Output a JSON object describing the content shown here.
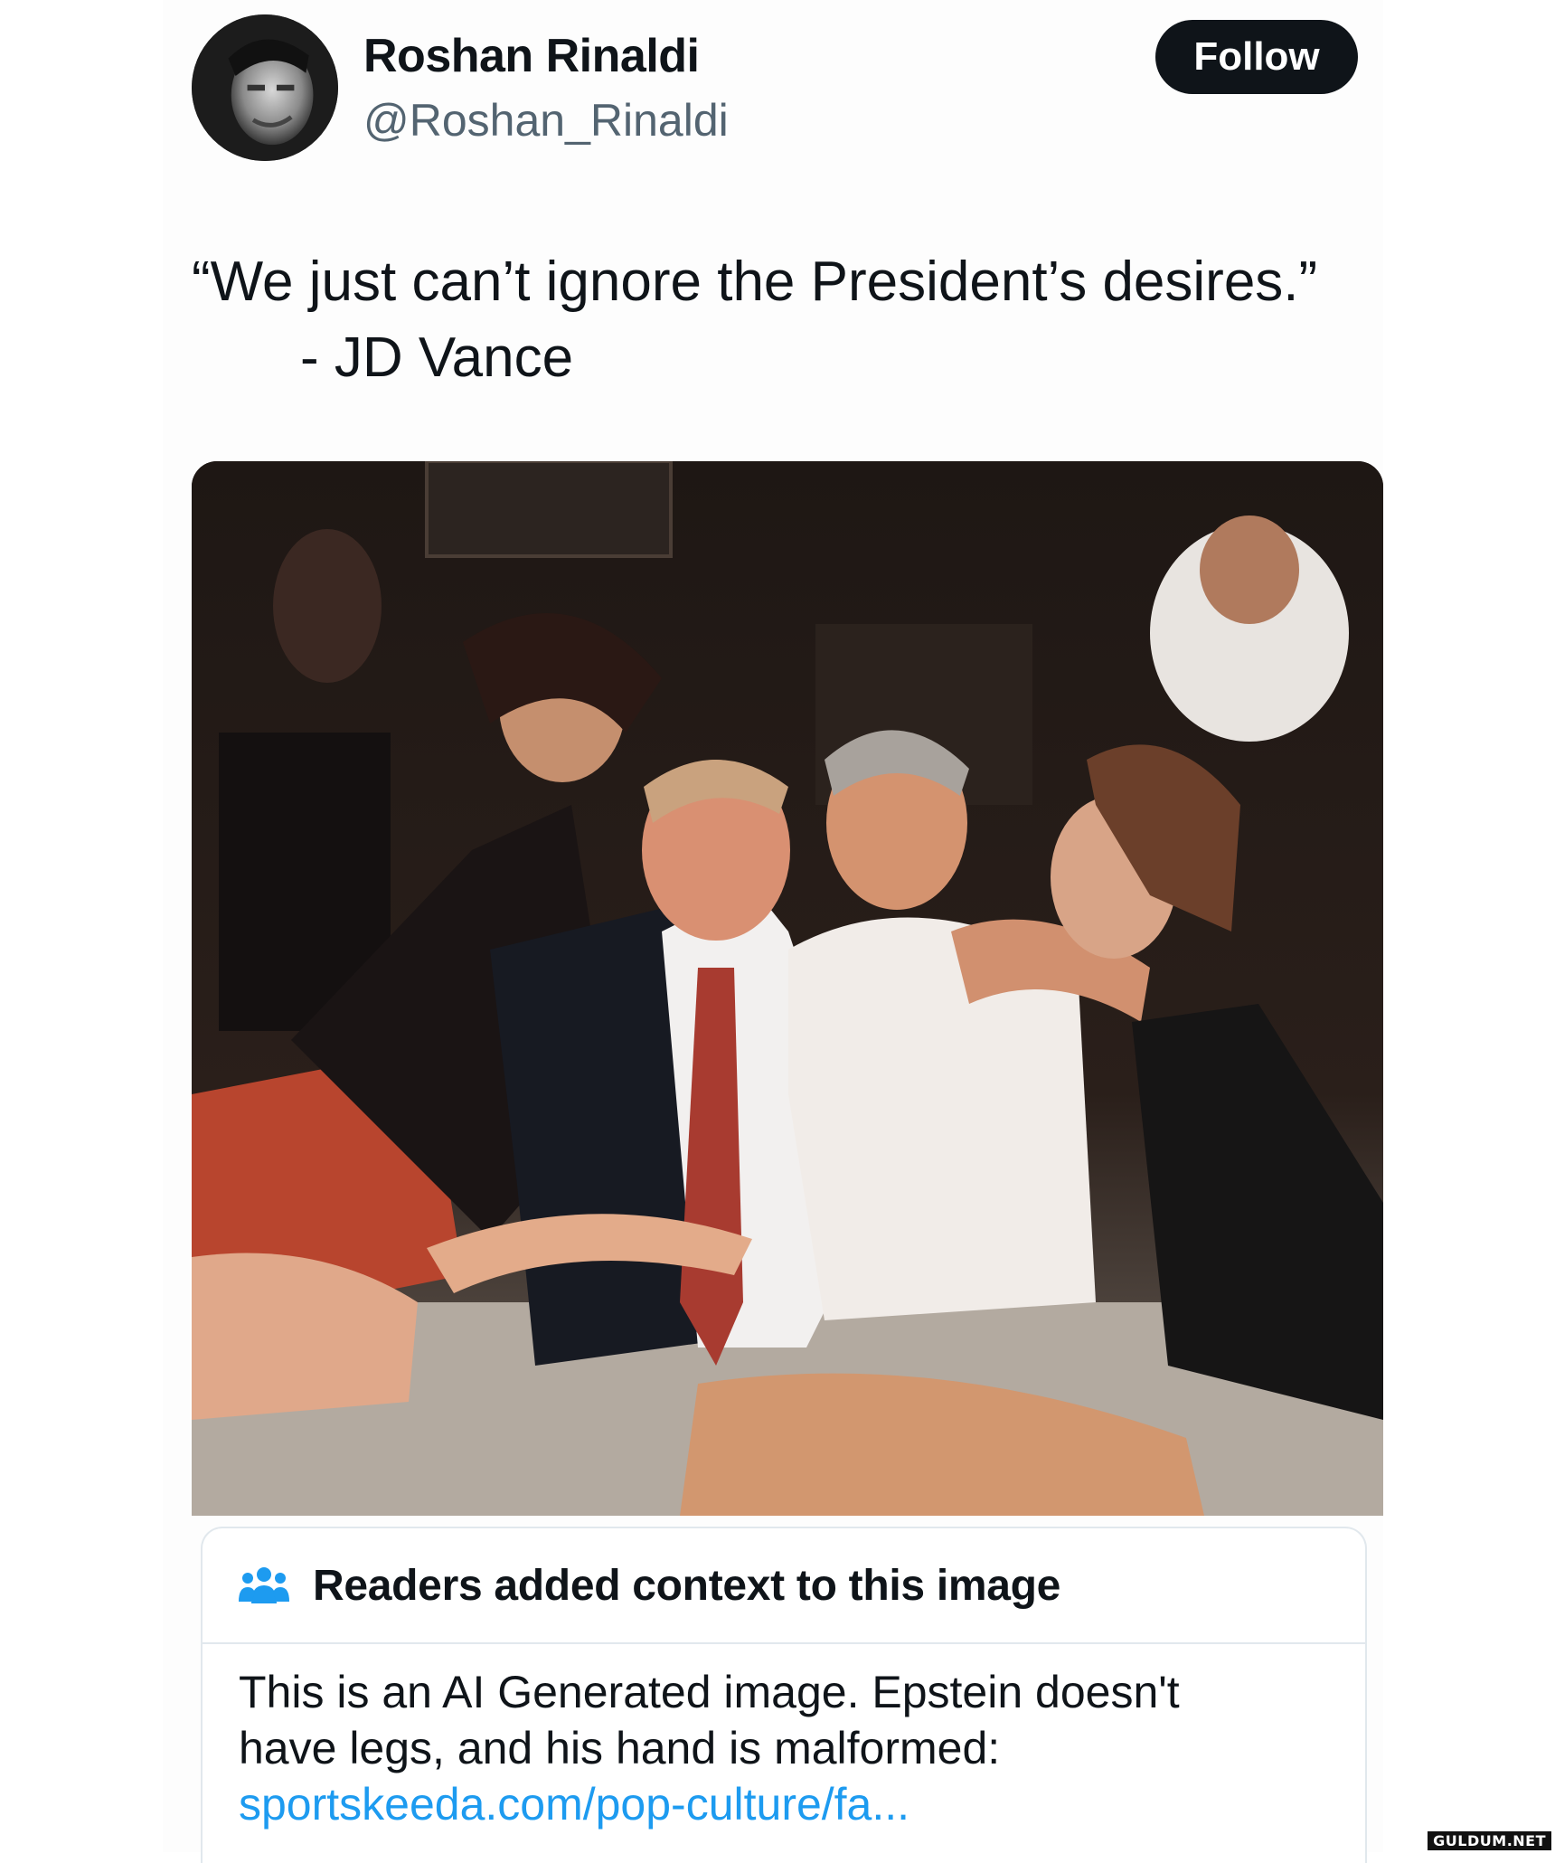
{
  "author": {
    "display_name": "Roshan Rinaldi",
    "handle": "@Roshan_Rinaldi",
    "avatar_icon": "profile-photo"
  },
  "follow_label": "Follow",
  "tweet": {
    "quote_line": "“We just can’t ignore the President’s desires.”",
    "attribution": "- JD Vance"
  },
  "media": {
    "icon": "attached-photo"
  },
  "community_note": {
    "icon": "readers-icon",
    "title": "Readers added context to this image",
    "body_line1": "This is an AI Generated image. Epstein doesn't",
    "body_line2": "have legs, and his hand is malformed:",
    "link": "sportskeeda.com/pop-culture/fa..."
  },
  "watermark": "GULDUM.NET",
  "colors": {
    "follow_bg": "#0f1419",
    "link": "#1d9bf0",
    "note_icon": "#1d9bf0",
    "handle": "#536471"
  }
}
